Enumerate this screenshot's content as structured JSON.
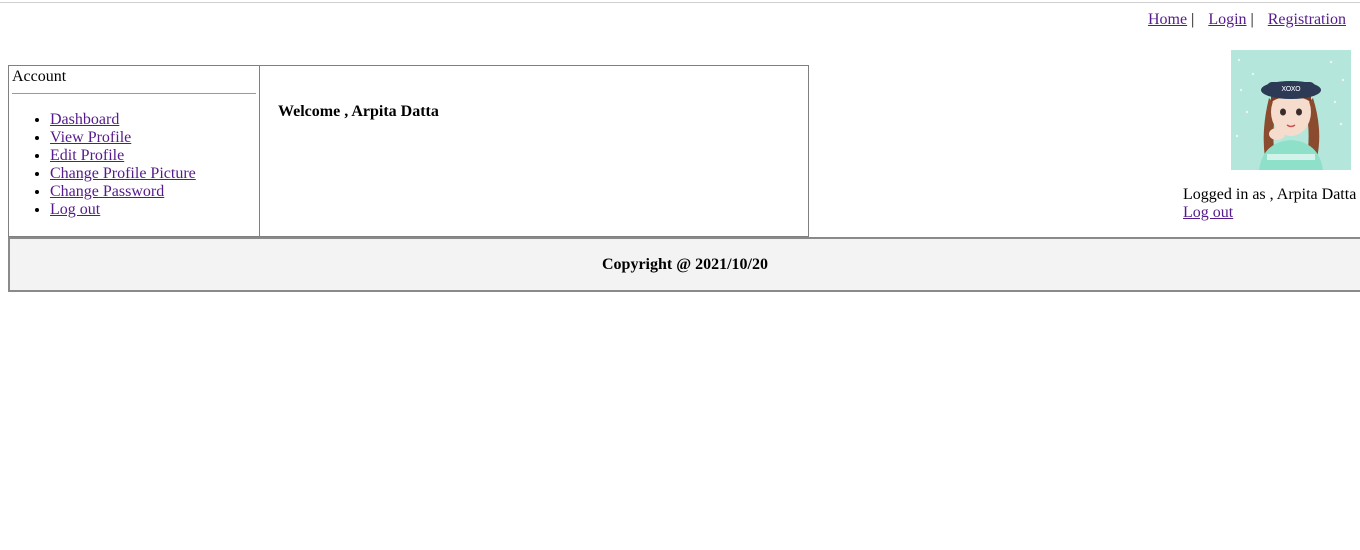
{
  "nav": {
    "home": "Home",
    "login": "Login",
    "registration": "Registration",
    "separator": "|"
  },
  "account": {
    "title": "Account",
    "menu": [
      "Dashboard",
      "View Profile",
      "Edit Profile",
      "Change Profile Picture",
      "Change Password",
      "Log out"
    ]
  },
  "main": {
    "welcome": "Welcome , Arpita Datta"
  },
  "user": {
    "logged_in_text": "Logged in as , Arpita Datta",
    "logout": "Log out",
    "avatar_icon": "avatar-icon"
  },
  "footer": {
    "copyright": "Copyright @ 2021/10/20"
  },
  "colors": {
    "link": "#551a8b",
    "footer_bg": "#f3f3f3",
    "border": "#808080",
    "avatar_bg": "#b5e6db"
  }
}
